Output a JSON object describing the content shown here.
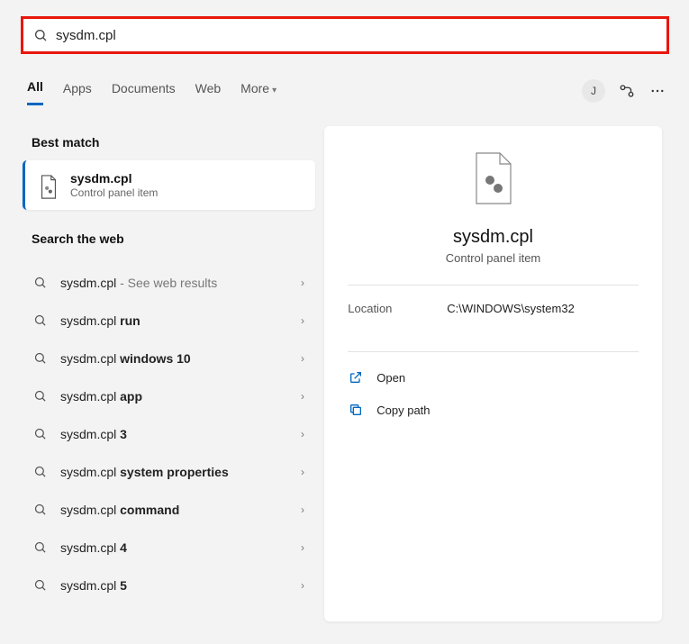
{
  "search": {
    "query": "sysdm.cpl"
  },
  "tabs": {
    "all": "All",
    "apps": "Apps",
    "documents": "Documents",
    "web": "Web",
    "more": "More"
  },
  "avatar": {
    "initial": "J"
  },
  "sections": {
    "best": "Best match",
    "web": "Search the web"
  },
  "bestMatch": {
    "title": "sysdm.cpl",
    "subtitle": "Control panel item"
  },
  "webResults": [
    {
      "prefix": "sysdm.cpl",
      "bold": "",
      "hint": " - See web results"
    },
    {
      "prefix": "sysdm.cpl ",
      "bold": "run",
      "hint": ""
    },
    {
      "prefix": "sysdm.cpl ",
      "bold": "windows 10",
      "hint": ""
    },
    {
      "prefix": "sysdm.cpl ",
      "bold": "app",
      "hint": ""
    },
    {
      "prefix": "sysdm.cpl ",
      "bold": "3",
      "hint": ""
    },
    {
      "prefix": "sysdm.cpl ",
      "bold": "system properties",
      "hint": ""
    },
    {
      "prefix": "sysdm.cpl ",
      "bold": "command",
      "hint": ""
    },
    {
      "prefix": "sysdm.cpl ",
      "bold": "4",
      "hint": ""
    },
    {
      "prefix": "sysdm.cpl ",
      "bold": "5",
      "hint": ""
    }
  ],
  "detail": {
    "title": "sysdm.cpl",
    "subtitle": "Control panel item",
    "location_label": "Location",
    "location_value": "C:\\WINDOWS\\system32",
    "actions": {
      "open": "Open",
      "copy": "Copy path"
    }
  }
}
